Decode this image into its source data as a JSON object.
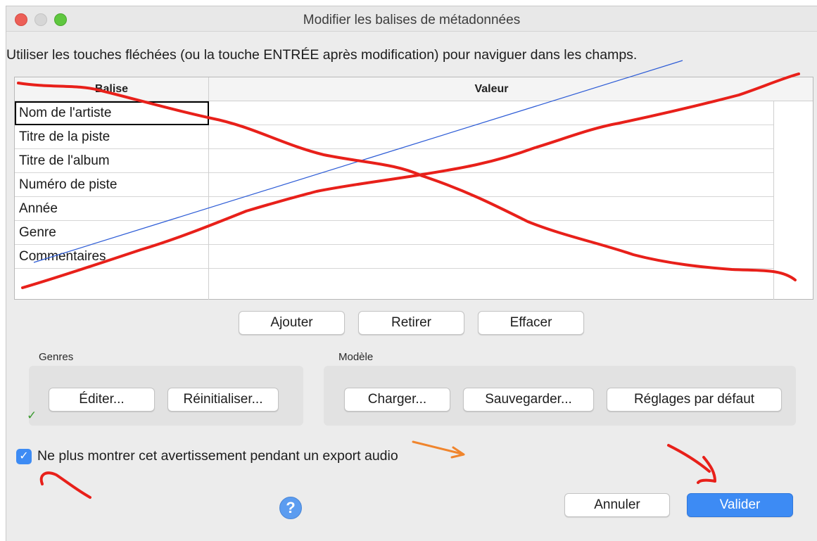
{
  "window": {
    "title": "Modifier les balises de métadonnées",
    "controls": [
      "close",
      "minimize",
      "zoom"
    ]
  },
  "instruction": "Utiliser les touches fléchées (ou la touche ENTRÉE après modification) pour naviguer dans les champs.",
  "table": {
    "columns": [
      "Balise",
      "Valeur"
    ],
    "rows": [
      {
        "tag": "Nom de l'artiste",
        "value": ""
      },
      {
        "tag": "Titre de la piste",
        "value": ""
      },
      {
        "tag": "Titre de l'album",
        "value": ""
      },
      {
        "tag": "Numéro de piste",
        "value": ""
      },
      {
        "tag": "Année",
        "value": ""
      },
      {
        "tag": "Genre",
        "value": ""
      },
      {
        "tag": "Commentaires",
        "value": ""
      },
      {
        "tag": "",
        "value": ""
      }
    ]
  },
  "row_buttons": {
    "add": "Ajouter",
    "remove": "Retirer",
    "clear": "Effacer"
  },
  "genres": {
    "label": "Genres",
    "edit": "Éditer...",
    "reset": "Réinitialiser..."
  },
  "template": {
    "label": "Modèle",
    "load": "Charger...",
    "save": "Sauvegarder...",
    "defaults": "Réglages par défaut"
  },
  "dont_show_again": {
    "label": "Ne plus montrer cet avertissement pendant un export audio",
    "checked": true
  },
  "footer": {
    "help": "?",
    "cancel": "Annuler",
    "ok": "Valider"
  },
  "annotation_colors": {
    "red_marker": "#e8201a",
    "blue_line": "#2c5bd6",
    "orange_arrow": "#f0852d",
    "green_tick": "#3a9a2f",
    "accent": "#3d8bf4"
  }
}
